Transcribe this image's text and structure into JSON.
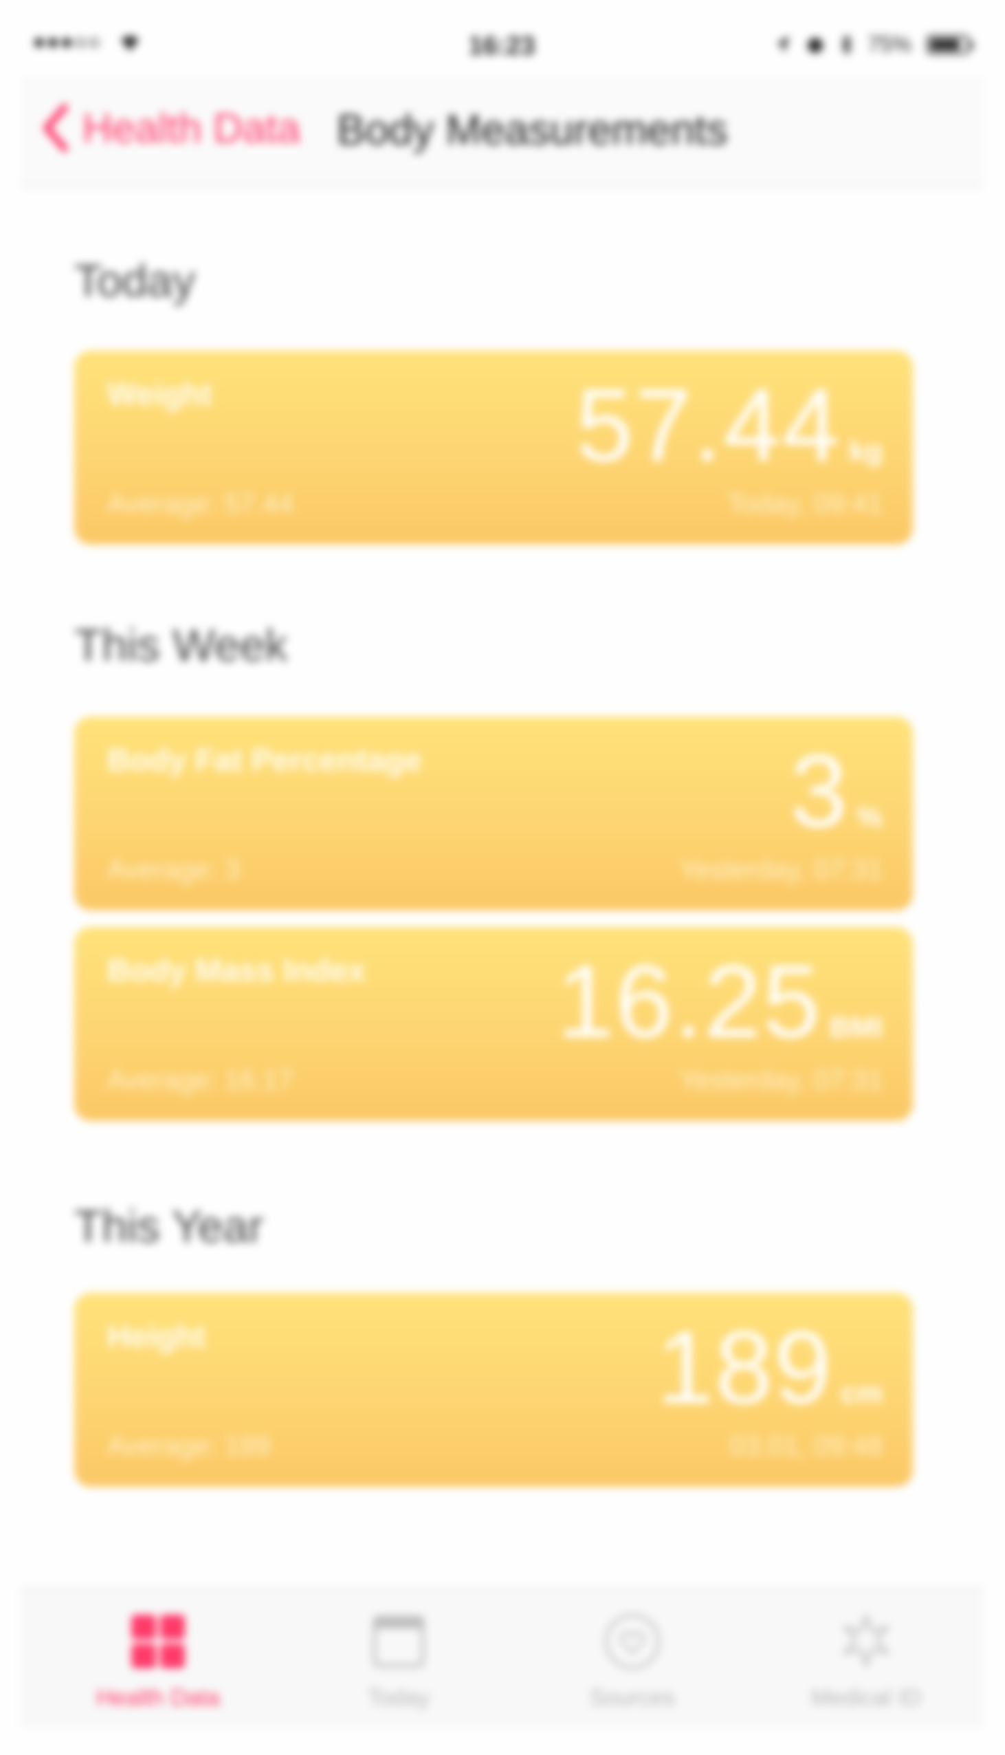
{
  "status_bar": {
    "carrier": "",
    "time": "16:23",
    "battery": "75%"
  },
  "nav": {
    "back_label": "Health Data",
    "title": "Body Measurements"
  },
  "sections": [
    {
      "header": "Today",
      "cards": [
        {
          "title": "Weight",
          "value": "57.44",
          "unit": "kg",
          "average": "Average: 57.44",
          "date": "Today, 09:41"
        }
      ]
    },
    {
      "header": "This Week",
      "cards": [
        {
          "title": "Body Fat Percentage",
          "value": "3",
          "unit": "%",
          "average": "Average: 3",
          "date": "Yesterday, 07:31"
        },
        {
          "title": "Body Mass Index",
          "value": "16.25",
          "unit": "BMI",
          "average": "Average: 16.17",
          "date": "Yesterday, 07:31"
        }
      ]
    },
    {
      "header": "This Year",
      "cards": [
        {
          "title": "Height",
          "value": "189",
          "unit": "cm",
          "average": "Average: 189",
          "date": "03.01, 09:48"
        }
      ]
    }
  ],
  "tabs": [
    {
      "label": "Health Data",
      "icon": "grid-icon",
      "active": true
    },
    {
      "label": "Today",
      "icon": "calendar-icon",
      "active": false
    },
    {
      "label": "Sources",
      "icon": "heart-icon",
      "active": false
    },
    {
      "label": "Medical ID",
      "icon": "asterisk-icon",
      "active": false
    }
  ],
  "colors": {
    "accent": "#ff3b6b",
    "card_top": "#ffe27a",
    "card_bottom": "#fbc866"
  }
}
